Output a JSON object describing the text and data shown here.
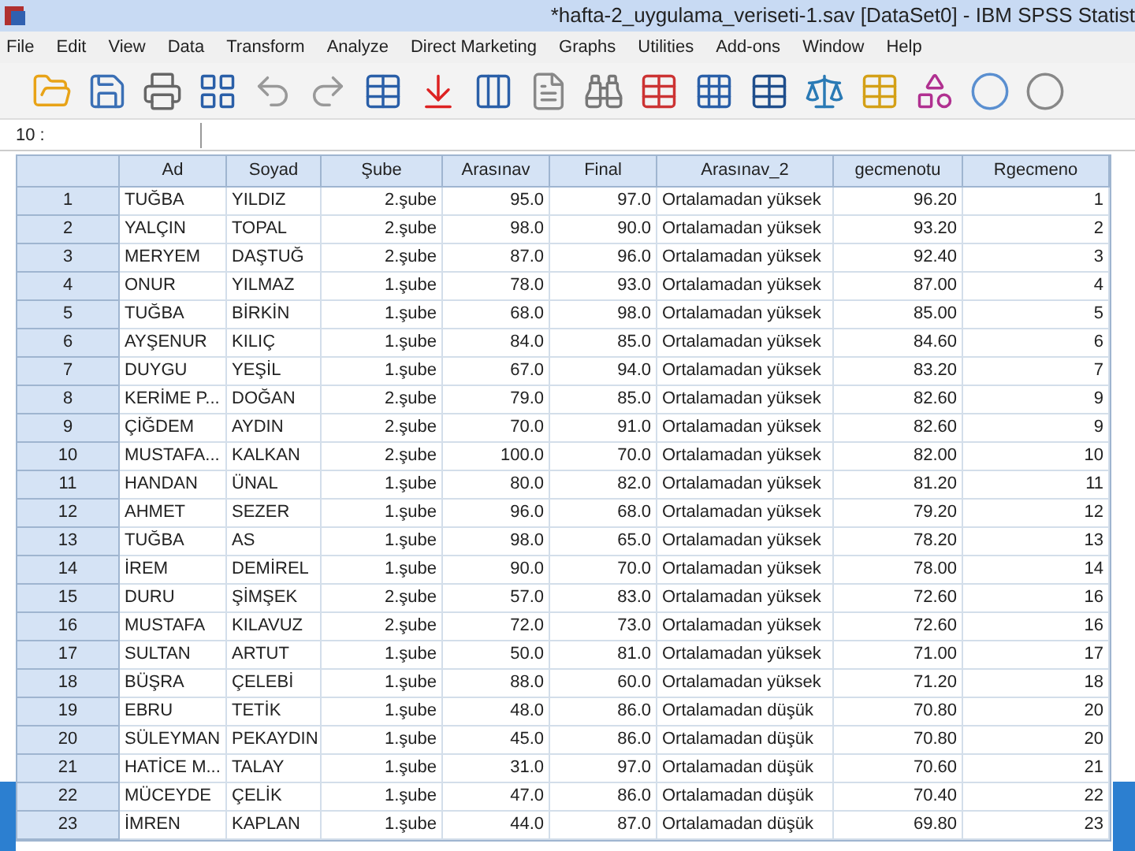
{
  "window": {
    "title": "*hafta-2_uygulama_veriseti-1.sav [DataSet0] - IBM SPSS Statist"
  },
  "menu": [
    "File",
    "Edit",
    "View",
    "Data",
    "Transform",
    "Analyze",
    "Direct Marketing",
    "Graphs",
    "Utilities",
    "Add-ons",
    "Window",
    "Help"
  ],
  "cell_editor": {
    "label": "10 :"
  },
  "table": {
    "columns": [
      {
        "label": "Ad",
        "kind": "text"
      },
      {
        "label": "Soyad",
        "kind": "text"
      },
      {
        "label": "Şube",
        "kind": "number"
      },
      {
        "label": "Arasınav",
        "kind": "number"
      },
      {
        "label": "Final",
        "kind": "number"
      },
      {
        "label": "Arasınav_2",
        "kind": "text"
      },
      {
        "label": "gecmenotu",
        "kind": "number"
      },
      {
        "label": "Rgecmeno",
        "kind": "number"
      }
    ],
    "rows": [
      {
        "number": "1",
        "cells": [
          "TUĞBA",
          "YILDIZ",
          "2.şube",
          "95.0",
          "97.0",
          "Ortalamadan yüksek",
          "96.20",
          "1"
        ]
      },
      {
        "number": "2",
        "cells": [
          "YALÇIN",
          "TOPAL",
          "2.şube",
          "98.0",
          "90.0",
          "Ortalamadan yüksek",
          "93.20",
          "2"
        ]
      },
      {
        "number": "3",
        "cells": [
          "MERYEM",
          "DAŞTUĞ",
          "2.şube",
          "87.0",
          "96.0",
          "Ortalamadan yüksek",
          "92.40",
          "3"
        ]
      },
      {
        "number": "4",
        "cells": [
          "ONUR",
          "YILMAZ",
          "1.şube",
          "78.0",
          "93.0",
          "Ortalamadan yüksek",
          "87.00",
          "4"
        ]
      },
      {
        "number": "5",
        "cells": [
          "TUĞBA",
          "BİRKİN",
          "1.şube",
          "68.0",
          "98.0",
          "Ortalamadan yüksek",
          "85.00",
          "5"
        ]
      },
      {
        "number": "6",
        "cells": [
          "AYŞENUR",
          "KILIÇ",
          "1.şube",
          "84.0",
          "85.0",
          "Ortalamadan yüksek",
          "84.60",
          "6"
        ]
      },
      {
        "number": "7",
        "cells": [
          "DUYGU",
          "YEŞİL",
          "1.şube",
          "67.0",
          "94.0",
          "Ortalamadan yüksek",
          "83.20",
          "7"
        ]
      },
      {
        "number": "8",
        "cells": [
          "KERİME P...",
          "DOĞAN",
          "2.şube",
          "79.0",
          "85.0",
          "Ortalamadan yüksek",
          "82.60",
          "9"
        ]
      },
      {
        "number": "9",
        "cells": [
          "ÇİĞDEM",
          "AYDIN",
          "2.şube",
          "70.0",
          "91.0",
          "Ortalamadan yüksek",
          "82.60",
          "9"
        ]
      },
      {
        "number": "10",
        "cells": [
          "MUSTAFA...",
          "KALKAN",
          "2.şube",
          "100.0",
          "70.0",
          "Ortalamadan yüksek",
          "82.00",
          "10"
        ]
      },
      {
        "number": "11",
        "cells": [
          "HANDAN",
          "ÜNAL",
          "1.şube",
          "80.0",
          "82.0",
          "Ortalamadan yüksek",
          "81.20",
          "11"
        ]
      },
      {
        "number": "12",
        "cells": [
          "AHMET",
          "SEZER",
          "1.şube",
          "96.0",
          "68.0",
          "Ortalamadan yüksek",
          "79.20",
          "12"
        ]
      },
      {
        "number": "13",
        "cells": [
          "TUĞBA",
          "AS",
          "1.şube",
          "98.0",
          "65.0",
          "Ortalamadan yüksek",
          "78.20",
          "13"
        ]
      },
      {
        "number": "14",
        "cells": [
          "İREM",
          "DEMİREL",
          "1.şube",
          "90.0",
          "70.0",
          "Ortalamadan yüksek",
          "78.00",
          "14"
        ]
      },
      {
        "number": "15",
        "cells": [
          "DURU",
          "ŞİMŞEK",
          "2.şube",
          "57.0",
          "83.0",
          "Ortalamadan yüksek",
          "72.60",
          "16"
        ]
      },
      {
        "number": "16",
        "cells": [
          "MUSTAFA",
          "KILAVUZ",
          "2.şube",
          "72.0",
          "73.0",
          "Ortalamadan yüksek",
          "72.60",
          "16"
        ]
      },
      {
        "number": "17",
        "cells": [
          "SULTAN",
          "ARTUT",
          "1.şube",
          "50.0",
          "81.0",
          "Ortalamadan yüksek",
          "71.00",
          "17"
        ]
      },
      {
        "number": "18",
        "cells": [
          "BÜŞRA",
          "ÇELEBİ",
          "1.şube",
          "88.0",
          "60.0",
          "Ortalamadan yüksek",
          "71.20",
          "18"
        ]
      },
      {
        "number": "19",
        "cells": [
          "EBRU",
          "TETİK",
          "1.şube",
          "48.0",
          "86.0",
          "Ortalamadan düşük",
          "70.80",
          "20"
        ]
      },
      {
        "number": "20",
        "cells": [
          "SÜLEYMAN",
          "PEKAYDIN",
          "1.şube",
          "45.0",
          "86.0",
          "Ortalamadan düşük",
          "70.80",
          "20"
        ]
      },
      {
        "number": "21",
        "cells": [
          "HATİCE M...",
          "TALAY",
          "1.şube",
          "31.0",
          "97.0",
          "Ortalamadan düşük",
          "70.60",
          "21"
        ]
      },
      {
        "number": "22",
        "cells": [
          "MÜCEYDE",
          "ÇELİK",
          "1.şube",
          "47.0",
          "86.0",
          "Ortalamadan düşük",
          "70.40",
          "22"
        ]
      },
      {
        "number": "23",
        "cells": [
          "İMREN",
          "KAPLAN",
          "1.şube",
          "44.0",
          "87.0",
          "Ortalamadan düşük",
          "69.80",
          "23"
        ]
      }
    ]
  }
}
